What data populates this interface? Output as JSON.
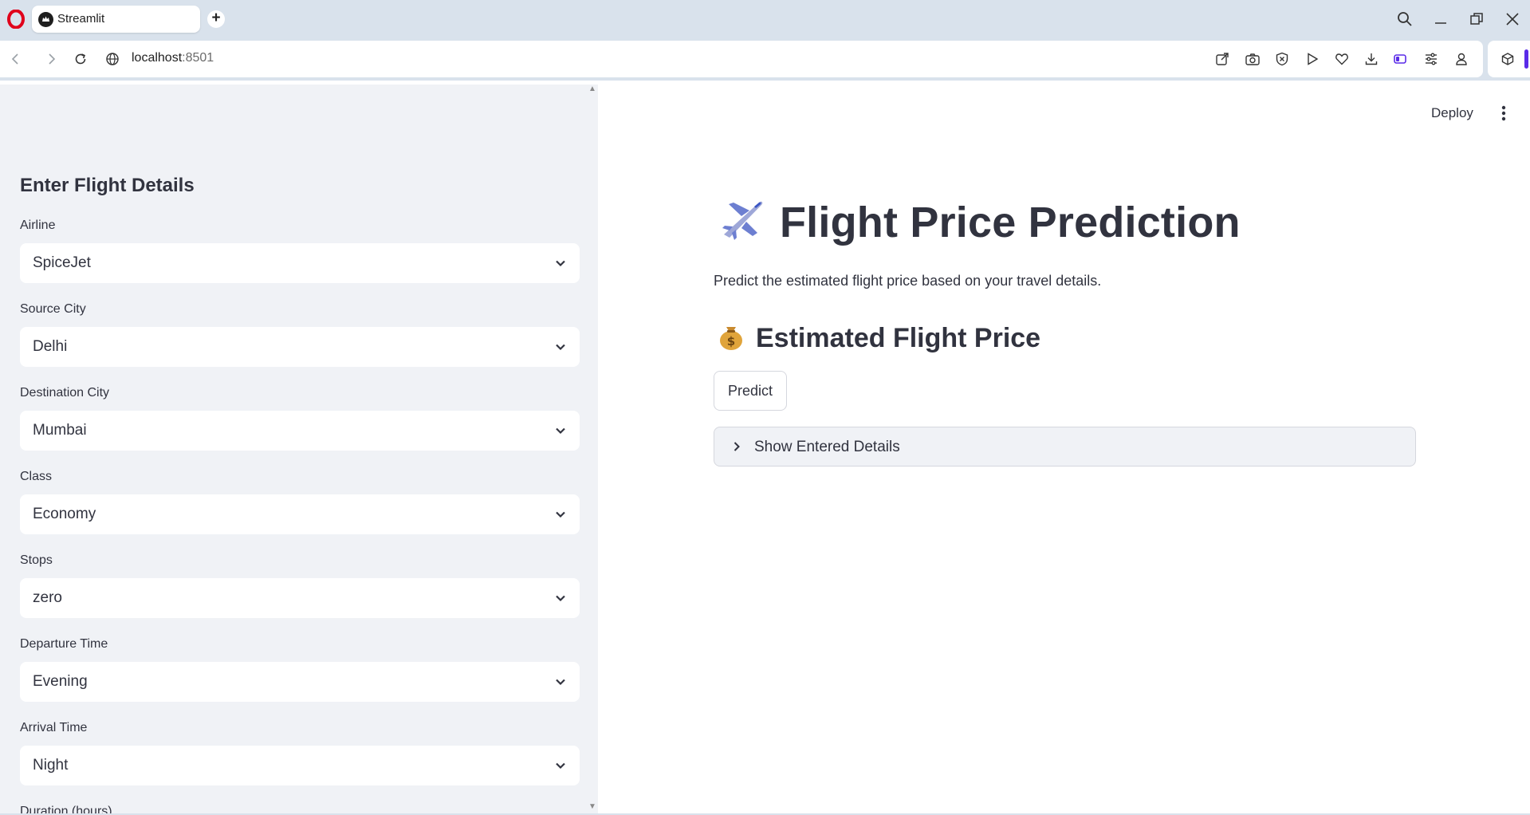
{
  "browser": {
    "tab_title": "Streamlit",
    "url_host": "localhost",
    "url_port": ":8501",
    "accent": "#5a2be8"
  },
  "sidebar": {
    "heading": "Enter Flight Details",
    "fields": [
      {
        "label": "Airline",
        "value": "SpiceJet"
      },
      {
        "label": "Source City",
        "value": "Delhi"
      },
      {
        "label": "Destination City",
        "value": "Mumbai"
      },
      {
        "label": "Class",
        "value": "Economy"
      },
      {
        "label": "Stops",
        "value": "zero"
      },
      {
        "label": "Departure Time",
        "value": "Evening"
      },
      {
        "label": "Arrival Time",
        "value": "Night"
      }
    ],
    "partial_label": "Duration (hours)"
  },
  "header": {
    "deploy_label": "Deploy"
  },
  "main": {
    "title_emoji": "✈️",
    "title": "Flight Price Prediction",
    "subtitle": "Predict the estimated flight price based on your travel details.",
    "section_emoji": "💰",
    "section_title": "Estimated Flight Price",
    "predict_label": "Predict",
    "expander_label": "Show Entered Details"
  }
}
